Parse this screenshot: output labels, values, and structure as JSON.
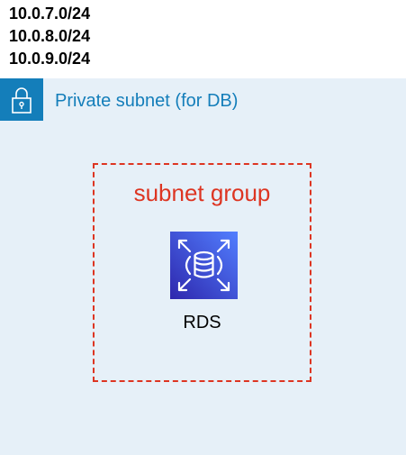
{
  "cidr_blocks": [
    "10.0.7.0/24",
    "10.0.8.0/24",
    "10.0.9.0/24"
  ],
  "private_subnet": {
    "label": "Private subnet (for DB)",
    "icon": "lock-icon",
    "color": "#147eba",
    "background": "#e6f0f8"
  },
  "subnet_group": {
    "label": "subnet group",
    "color": "#dd3522"
  },
  "rds": {
    "label": "RDS",
    "icon": "rds-database-icon"
  }
}
